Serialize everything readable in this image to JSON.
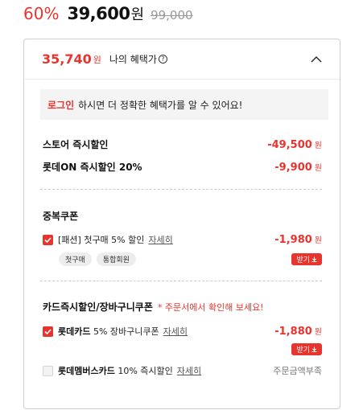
{
  "price": {
    "discount_rate": "60%",
    "sale_price": "39,600",
    "currency": "원",
    "original_price": "99,000"
  },
  "benefits": {
    "total": "35,740",
    "currency": "원",
    "title": "나의 혜택가",
    "help_icon_glyph": "?",
    "login_link": "로그인",
    "login_message": "하시면 더 정확한 혜택가를 알 수 있어요!",
    "rows": [
      {
        "label": "스토어 즉시할인",
        "amount": "-49,500",
        "currency": "원"
      },
      {
        "label": "롯데ON 즉시할인 20%",
        "amount": "-9,900",
        "currency": "원"
      }
    ]
  },
  "duplicate_coupon": {
    "title": "중복쿠폰",
    "coupon_label": "[패션] 첫구매 5% 할인",
    "detail_link": "자세히",
    "tags": [
      "첫구매",
      "통합회원"
    ],
    "amount": "-1,980",
    "currency": "원",
    "get_button": "받기"
  },
  "card_section": {
    "title": "카드즉시할인/장바구니쿠폰",
    "note": "* 주문서에서 확인해 보세요!",
    "items": [
      {
        "name_bold": "롯데카드",
        "name_rest": " 5% 장바구니쿠폰",
        "detail_link": "자세히",
        "amount": "-1,880",
        "currency": "원",
        "get_button": "받기",
        "checked": true
      },
      {
        "name_bold": "롯데멤버스카드",
        "name_rest": " 10% 즉시할인",
        "detail_link": "자세히",
        "status": "주문금액부족",
        "checked": false
      }
    ]
  },
  "colors": {
    "accent": "#e8342e",
    "border": "#cfcfcf",
    "login_bg": "#f4f4f4"
  }
}
